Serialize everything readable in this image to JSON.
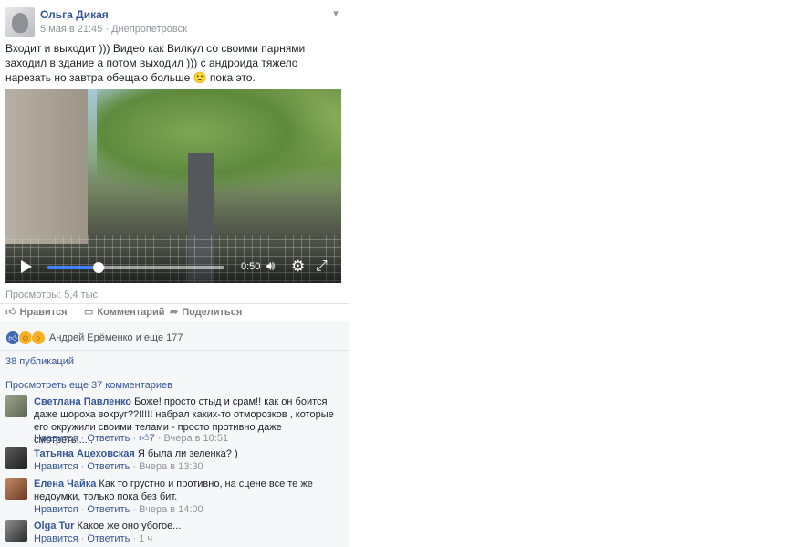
{
  "post": {
    "author": "Ольга Дикая",
    "date": "5 мая в 21:45",
    "location": "Днепропетровск",
    "separator": "·",
    "text": "Входит и выходит ))) Видео как Вилкул со своими парнями заходил в здание а потом выходил ))) с андроида тяжело нарезать но завтра обещаю больше 🙂 пока это.",
    "views": "Просмотры: 5,4 тыс."
  },
  "video": {
    "time": "0:50",
    "progress": 0.29
  },
  "actions": {
    "like": "Нравится",
    "comment": "Комментарий",
    "share": "Поделиться"
  },
  "reactions": {
    "text": "Андрей Ерёменко и еще 177"
  },
  "shares": "38 публикаций",
  "more_comments": "Просмотреть еще 37 комментариев",
  "comments": [
    {
      "name": "Светлана Павленко",
      "text": "Боже! просто стыд и срам!! как он боится даже шороха вокруг??!!!!! набрал каких-то отморозков , которые его окружили своими телами - просто противно даже смотреть......",
      "like": "Нравится",
      "reply": "Ответить",
      "likes": "7",
      "time": "Вчера в 10:51"
    },
    {
      "name": "Татьяна Ацеховская",
      "text": "Я была ли зеленка? )",
      "like": "Нравится",
      "reply": "Ответить",
      "time": "Вчера в 13:30"
    },
    {
      "name": "Елена Чайка",
      "text": "Как то грустно и противно, на сцене все те же недоумки, только пока без бит.",
      "like": "Нравится",
      "reply": "Ответить",
      "time": "Вчера в 14:00"
    },
    {
      "name": "Olga Tur",
      "text": "Какое же оно убогое...",
      "like": "Нравится",
      "reply": "Ответить",
      "time": "1 ч"
    }
  ],
  "icons": {
    "play": "play-icon",
    "volume": "volume-icon",
    "settings": "gear-icon",
    "fullscreen": "expand-icon",
    "like": "thumbs-up-icon",
    "comment": "speech-bubble-icon",
    "share": "share-arrow-icon",
    "chevron": "chevron-down-icon"
  },
  "colors": {
    "link": "#365899",
    "meta": "#90949c",
    "accent": "#4080ff"
  }
}
